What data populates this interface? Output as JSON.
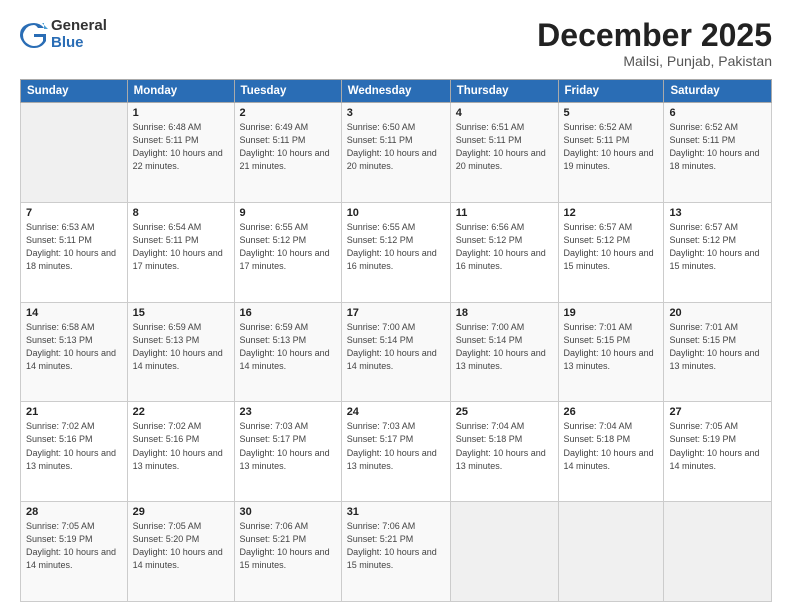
{
  "logo": {
    "general": "General",
    "blue": "Blue"
  },
  "title": "December 2025",
  "location": "Mailsi, Punjab, Pakistan",
  "days_header": [
    "Sunday",
    "Monday",
    "Tuesday",
    "Wednesday",
    "Thursday",
    "Friday",
    "Saturday"
  ],
  "weeks": [
    [
      {
        "num": "",
        "empty": true
      },
      {
        "num": "1",
        "sunrise": "Sunrise: 6:48 AM",
        "sunset": "Sunset: 5:11 PM",
        "daylight": "Daylight: 10 hours and 22 minutes."
      },
      {
        "num": "2",
        "sunrise": "Sunrise: 6:49 AM",
        "sunset": "Sunset: 5:11 PM",
        "daylight": "Daylight: 10 hours and 21 minutes."
      },
      {
        "num": "3",
        "sunrise": "Sunrise: 6:50 AM",
        "sunset": "Sunset: 5:11 PM",
        "daylight": "Daylight: 10 hours and 20 minutes."
      },
      {
        "num": "4",
        "sunrise": "Sunrise: 6:51 AM",
        "sunset": "Sunset: 5:11 PM",
        "daylight": "Daylight: 10 hours and 20 minutes."
      },
      {
        "num": "5",
        "sunrise": "Sunrise: 6:52 AM",
        "sunset": "Sunset: 5:11 PM",
        "daylight": "Daylight: 10 hours and 19 minutes."
      },
      {
        "num": "6",
        "sunrise": "Sunrise: 6:52 AM",
        "sunset": "Sunset: 5:11 PM",
        "daylight": "Daylight: 10 hours and 18 minutes."
      }
    ],
    [
      {
        "num": "7",
        "sunrise": "Sunrise: 6:53 AM",
        "sunset": "Sunset: 5:11 PM",
        "daylight": "Daylight: 10 hours and 18 minutes."
      },
      {
        "num": "8",
        "sunrise": "Sunrise: 6:54 AM",
        "sunset": "Sunset: 5:11 PM",
        "daylight": "Daylight: 10 hours and 17 minutes."
      },
      {
        "num": "9",
        "sunrise": "Sunrise: 6:55 AM",
        "sunset": "Sunset: 5:12 PM",
        "daylight": "Daylight: 10 hours and 17 minutes."
      },
      {
        "num": "10",
        "sunrise": "Sunrise: 6:55 AM",
        "sunset": "Sunset: 5:12 PM",
        "daylight": "Daylight: 10 hours and 16 minutes."
      },
      {
        "num": "11",
        "sunrise": "Sunrise: 6:56 AM",
        "sunset": "Sunset: 5:12 PM",
        "daylight": "Daylight: 10 hours and 16 minutes."
      },
      {
        "num": "12",
        "sunrise": "Sunrise: 6:57 AM",
        "sunset": "Sunset: 5:12 PM",
        "daylight": "Daylight: 10 hours and 15 minutes."
      },
      {
        "num": "13",
        "sunrise": "Sunrise: 6:57 AM",
        "sunset": "Sunset: 5:12 PM",
        "daylight": "Daylight: 10 hours and 15 minutes."
      }
    ],
    [
      {
        "num": "14",
        "sunrise": "Sunrise: 6:58 AM",
        "sunset": "Sunset: 5:13 PM",
        "daylight": "Daylight: 10 hours and 14 minutes."
      },
      {
        "num": "15",
        "sunrise": "Sunrise: 6:59 AM",
        "sunset": "Sunset: 5:13 PM",
        "daylight": "Daylight: 10 hours and 14 minutes."
      },
      {
        "num": "16",
        "sunrise": "Sunrise: 6:59 AM",
        "sunset": "Sunset: 5:13 PM",
        "daylight": "Daylight: 10 hours and 14 minutes."
      },
      {
        "num": "17",
        "sunrise": "Sunrise: 7:00 AM",
        "sunset": "Sunset: 5:14 PM",
        "daylight": "Daylight: 10 hours and 14 minutes."
      },
      {
        "num": "18",
        "sunrise": "Sunrise: 7:00 AM",
        "sunset": "Sunset: 5:14 PM",
        "daylight": "Daylight: 10 hours and 13 minutes."
      },
      {
        "num": "19",
        "sunrise": "Sunrise: 7:01 AM",
        "sunset": "Sunset: 5:15 PM",
        "daylight": "Daylight: 10 hours and 13 minutes."
      },
      {
        "num": "20",
        "sunrise": "Sunrise: 7:01 AM",
        "sunset": "Sunset: 5:15 PM",
        "daylight": "Daylight: 10 hours and 13 minutes."
      }
    ],
    [
      {
        "num": "21",
        "sunrise": "Sunrise: 7:02 AM",
        "sunset": "Sunset: 5:16 PM",
        "daylight": "Daylight: 10 hours and 13 minutes."
      },
      {
        "num": "22",
        "sunrise": "Sunrise: 7:02 AM",
        "sunset": "Sunset: 5:16 PM",
        "daylight": "Daylight: 10 hours and 13 minutes."
      },
      {
        "num": "23",
        "sunrise": "Sunrise: 7:03 AM",
        "sunset": "Sunset: 5:17 PM",
        "daylight": "Daylight: 10 hours and 13 minutes."
      },
      {
        "num": "24",
        "sunrise": "Sunrise: 7:03 AM",
        "sunset": "Sunset: 5:17 PM",
        "daylight": "Daylight: 10 hours and 13 minutes."
      },
      {
        "num": "25",
        "sunrise": "Sunrise: 7:04 AM",
        "sunset": "Sunset: 5:18 PM",
        "daylight": "Daylight: 10 hours and 13 minutes."
      },
      {
        "num": "26",
        "sunrise": "Sunrise: 7:04 AM",
        "sunset": "Sunset: 5:18 PM",
        "daylight": "Daylight: 10 hours and 14 minutes."
      },
      {
        "num": "27",
        "sunrise": "Sunrise: 7:05 AM",
        "sunset": "Sunset: 5:19 PM",
        "daylight": "Daylight: 10 hours and 14 minutes."
      }
    ],
    [
      {
        "num": "28",
        "sunrise": "Sunrise: 7:05 AM",
        "sunset": "Sunset: 5:19 PM",
        "daylight": "Daylight: 10 hours and 14 minutes."
      },
      {
        "num": "29",
        "sunrise": "Sunrise: 7:05 AM",
        "sunset": "Sunset: 5:20 PM",
        "daylight": "Daylight: 10 hours and 14 minutes."
      },
      {
        "num": "30",
        "sunrise": "Sunrise: 7:06 AM",
        "sunset": "Sunset: 5:21 PM",
        "daylight": "Daylight: 10 hours and 15 minutes."
      },
      {
        "num": "31",
        "sunrise": "Sunrise: 7:06 AM",
        "sunset": "Sunset: 5:21 PM",
        "daylight": "Daylight: 10 hours and 15 minutes."
      },
      {
        "num": "",
        "empty": true
      },
      {
        "num": "",
        "empty": true
      },
      {
        "num": "",
        "empty": true
      }
    ]
  ]
}
